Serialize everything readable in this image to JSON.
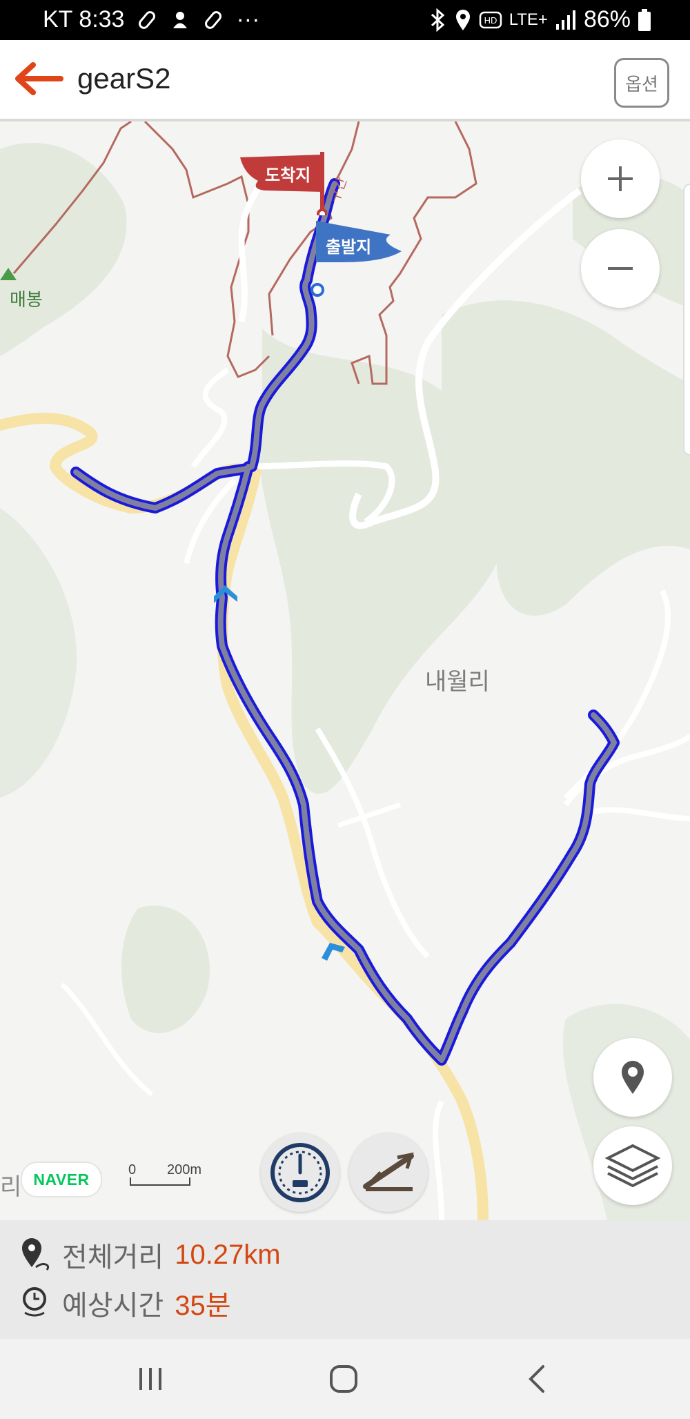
{
  "status_bar": {
    "carrier_time": "KT 8:33",
    "more": "···",
    "network": "LTE+",
    "battery": "86%"
  },
  "header": {
    "title": "gearS2",
    "option_label": "옵션"
  },
  "map": {
    "flags": {
      "arrival_label": "도착지",
      "departure_label": "출발지"
    },
    "labels": {
      "village": "내월리",
      "peak": "매봉",
      "edge_fragment": "리",
      "road_name": "구간"
    },
    "attribution": "NAVER",
    "scale": {
      "start": "0",
      "end": "200m"
    },
    "route_color": "#7d7d9a",
    "route_outline_color": "#1a1adb",
    "arrival_color": "#c23b3b",
    "departure_color": "#3f73c4"
  },
  "summary": {
    "distance_label": "전체거리",
    "distance_value": "10.27km",
    "time_label": "예상시간",
    "time_value": "35분",
    "value_color": "#d34711"
  }
}
